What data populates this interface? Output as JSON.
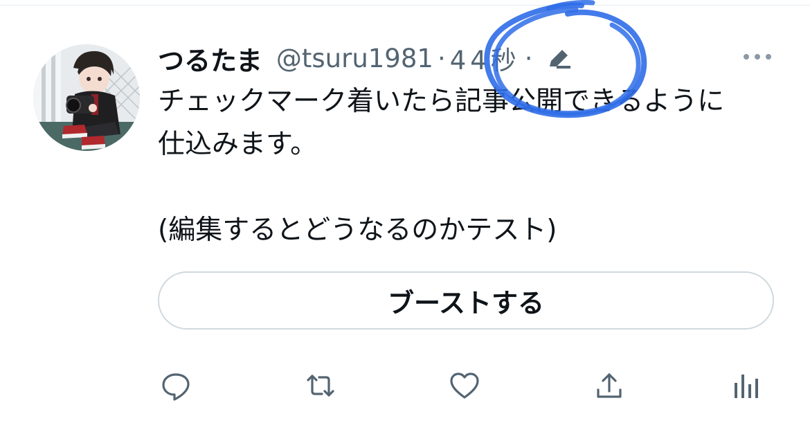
{
  "tweet": {
    "author": {
      "display_name": "つるたま",
      "handle": "@tsuru1981",
      "avatar_icon": "user-avatar-photo"
    },
    "separator": "·",
    "time": "44秒",
    "edited_icon": "pencil-icon",
    "body_lines": [
      "チェックマーク着いたら記事公開できるように",
      "仕込みます。",
      "",
      "(編集するとどうなるのかテスト)"
    ],
    "boost_label": "ブーストする",
    "actions": [
      "reply-icon",
      "retweet-icon",
      "like-icon",
      "share-icon",
      "analytics-icon"
    ]
  },
  "colors": {
    "text_primary": "#0f1419",
    "text_secondary": "#536471",
    "border": "#cfd9de",
    "annotation": "#2f6de8"
  }
}
